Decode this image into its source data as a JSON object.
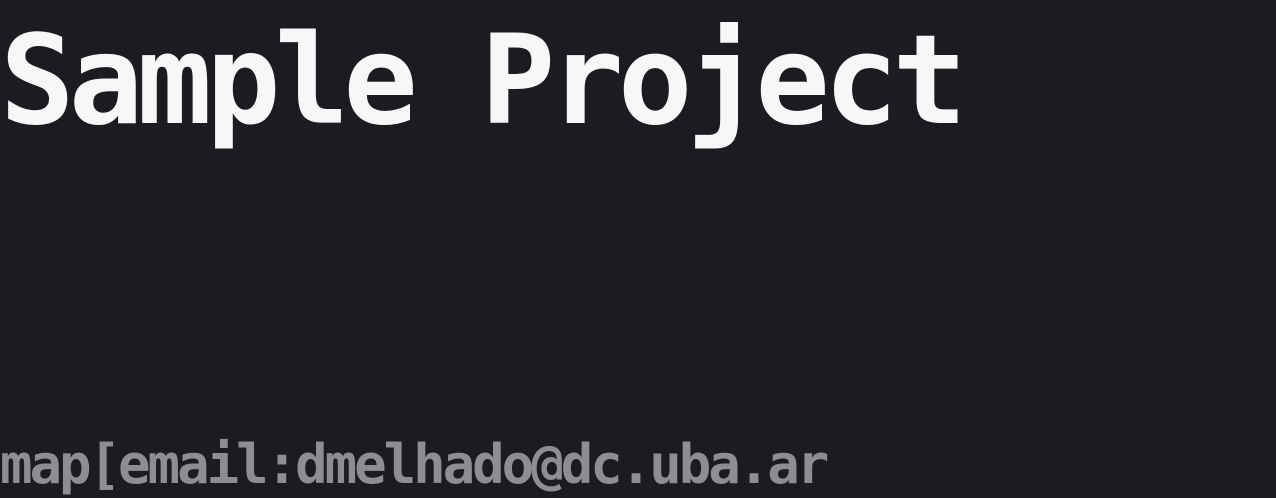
{
  "slide": {
    "title": "Sample Project",
    "author": "map[email:dmelhado@dc.uba.ar"
  },
  "colors": {
    "background": "#1b1c21",
    "title": "#f7f7f8",
    "author": "#8d8e93"
  }
}
